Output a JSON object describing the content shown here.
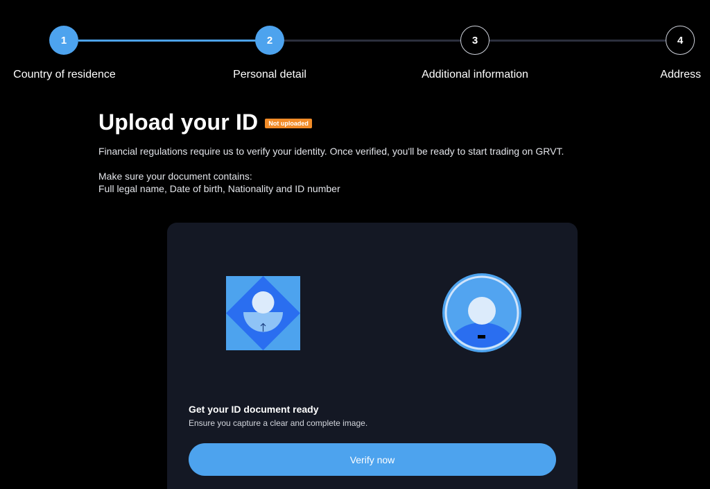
{
  "stepper": {
    "steps": [
      {
        "number": "1",
        "label": "Country of residence",
        "state": "complete"
      },
      {
        "number": "2",
        "label": "Personal detail",
        "state": "active"
      },
      {
        "number": "3",
        "label": "Additional information",
        "state": "upcoming"
      },
      {
        "number": "4",
        "label": "Address",
        "state": "upcoming"
      }
    ]
  },
  "main": {
    "title": "Upload your ID",
    "status_badge": "Not uploaded",
    "description": "Financial regulations require us to verify your identity. Once verified, you'll be ready to start trading on GRVT.",
    "requirements_title": "Make sure your document contains:",
    "requirements_list": "Full legal name, Date of birth, Nationality and ID number"
  },
  "card": {
    "id_illustration_icon": "id-document-upload-icon",
    "selfie_illustration_icon": "selfie-avatar-icon",
    "heading": "Get your ID document ready",
    "subtext": "Ensure you capture a clear and complete image.",
    "verify_button_label": "Verify now"
  },
  "colors": {
    "accent": "#4da3ee",
    "badge": "#f28c28",
    "card_background": "#141824",
    "page_background": "#000000"
  }
}
